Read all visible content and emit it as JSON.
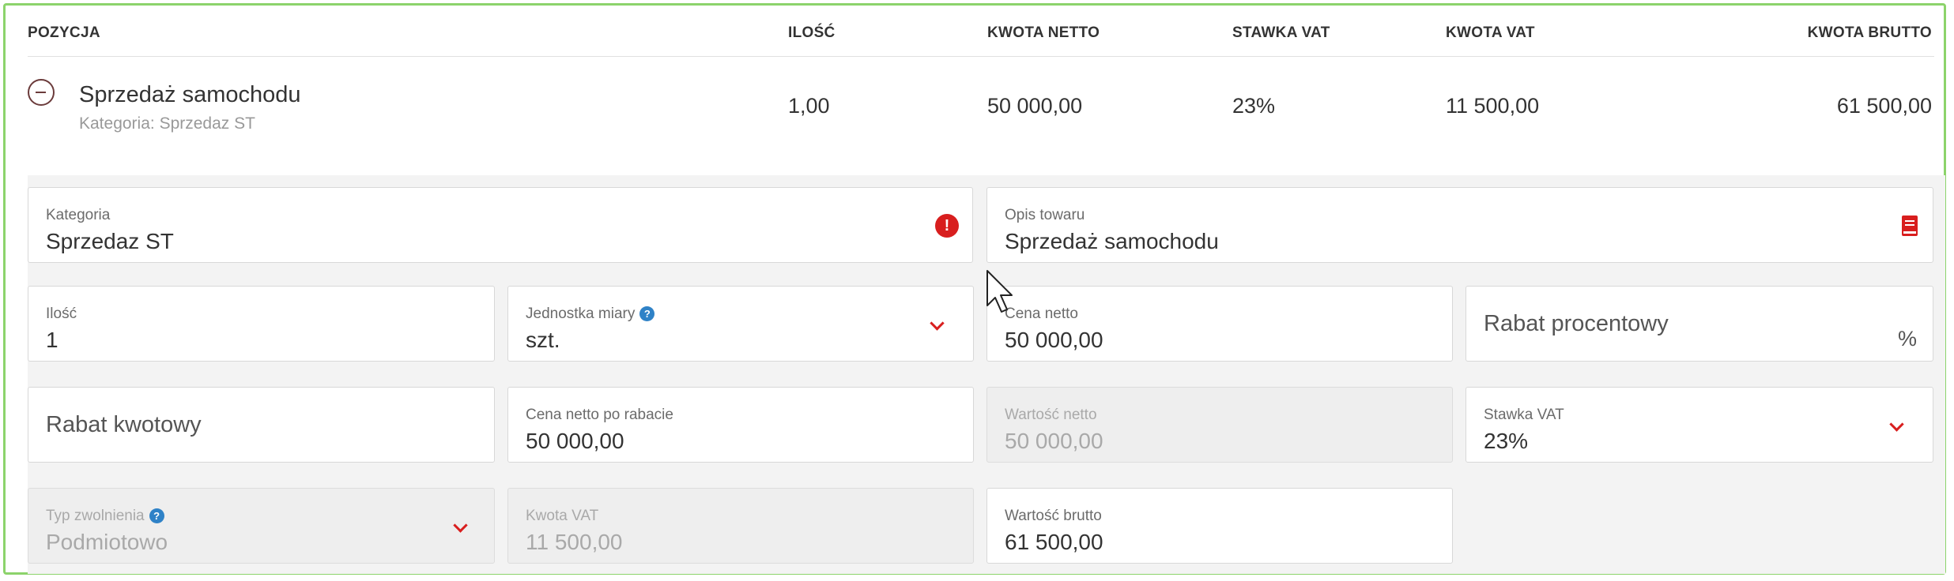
{
  "table": {
    "headers": [
      "POZYCJA",
      "ILOŚĆ",
      "KWOTA NETTO",
      "STAWKA VAT",
      "KWOTA VAT",
      "KWOTA BRUTTO"
    ],
    "row": {
      "name": "Sprzedaż samochodu",
      "category": "Kategoria: Sprzedaz ST",
      "quantity": "1,00",
      "net_amount": "50 000,00",
      "vat_rate": "23%",
      "vat_amount": "11 500,00",
      "gross_amount": "61 500,00"
    }
  },
  "form": {
    "kategoria": {
      "label": "Kategoria",
      "value": "Sprzedaz ST"
    },
    "opis": {
      "label": "Opis towaru",
      "value": "Sprzedaż samochodu"
    },
    "ilosc": {
      "label": "Ilość",
      "value": "1"
    },
    "jednostka": {
      "label": "Jednostka miary",
      "value": "szt."
    },
    "cena_netto": {
      "label": "Cena netto",
      "value": "50 000,00"
    },
    "rabat_procentowy": {
      "placeholder": "Rabat procentowy",
      "suffix": "%"
    },
    "rabat_kwotowy": {
      "placeholder": "Rabat kwotowy"
    },
    "cena_po_rabacie": {
      "label": "Cena netto po rabacie",
      "value": "50 000,00"
    },
    "wartosc_netto": {
      "label": "Wartość netto",
      "value": "50 000,00"
    },
    "stawka_vat": {
      "label": "Stawka VAT",
      "value": "23%"
    },
    "typ_zwolnienia": {
      "label": "Typ zwolnienia",
      "value": "Podmiotowo"
    },
    "kwota_vat": {
      "label": "Kwota VAT",
      "value": "11 500,00"
    },
    "wartosc_brutto": {
      "label": "Wartość brutto",
      "value": "61 500,00"
    }
  },
  "icons": {
    "help": "?",
    "alert": "!"
  },
  "colors": {
    "accent_red": "#d81e1e",
    "help_blue": "#2f82c7",
    "frame_green": "#8cd36b"
  }
}
